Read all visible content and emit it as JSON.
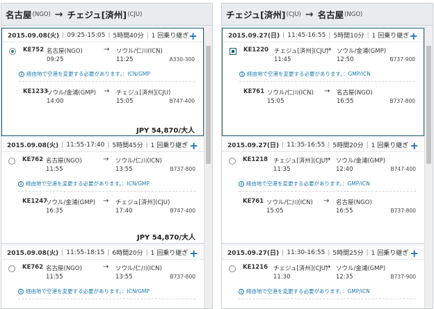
{
  "left": {
    "header": {
      "origin": "名古屋",
      "origin_code": "(NGO)",
      "arrow": "→",
      "dest": "チェジュ[済州]",
      "dest_code": "(CJU)"
    },
    "cards": [
      {
        "date": "2015.09.08(火)",
        "time": "09:25-15:05",
        "duration": "5時間40分",
        "stops": "1 回乗り継ぎ",
        "seg1": {
          "flight": "KE752",
          "from": "名古屋(NGO)",
          "to": "ソウル/仁川(ICN)",
          "dep": "09:25",
          "arr": "11:25",
          "aircraft": "A330-300"
        },
        "note": "経由地で空港を変更する必要があります。：ICN/GMP",
        "seg2": {
          "flight": "KE1233",
          "from": "ソウル/金浦(GMP)",
          "to": "チェジュ[済州](CJU)",
          "dep": "14:00",
          "arr": "15:05",
          "aircraft": "B747-400"
        },
        "price": "JPY 54,870/大人"
      },
      {
        "date": "2015.09.08(火)",
        "time": "11:55-17:40",
        "duration": "5時間45分",
        "stops": "1 回乗り継ぎ",
        "seg1": {
          "flight": "KE762",
          "from": "名古屋(NGO)",
          "to": "ソウル/仁川(ICN)",
          "dep": "11:55",
          "arr": "13:55",
          "aircraft": "B737-800"
        },
        "note": "経由地で空港を変更する必要があります。：ICN/GMP",
        "seg2": {
          "flight": "KE1247",
          "from": "ソウル/金浦(GMP)",
          "to": "チェジュ[済州](CJU)",
          "dep": "16:35",
          "arr": "17:40",
          "aircraft": "B747-400"
        },
        "price": "JPY 54,870/大人"
      },
      {
        "date": "2015.09.08(火)",
        "time": "11:55-18:15",
        "duration": "6時間20分",
        "stops": "1 回乗り継ぎ",
        "seg1": {
          "flight": "KE762",
          "from": "名古屋(NGO)",
          "to": "ソウル/仁川(ICN)",
          "dep": "11:55",
          "arr": "13:55",
          "aircraft": "B737-800"
        },
        "note": "経由地で空港を変更する必要があります。：ICN/GMP"
      }
    ]
  },
  "right": {
    "header": {
      "origin": "チェジュ[済州]",
      "origin_code": "(CJU)",
      "arrow": "→",
      "dest": "名古屋",
      "dest_code": "(NGO)"
    },
    "cards": [
      {
        "date": "2015.09.27(日)",
        "time": "11:45-16:55",
        "duration": "5時間10分",
        "stops": "1 回乗り継ぎ",
        "seg1": {
          "flight": "KE1220",
          "from": "チェジュ[済州](CJU)",
          "to": "ソウル/金浦(GMP)",
          "dep": "11:45",
          "arr": "12:50",
          "aircraft": "B737-900"
        },
        "note": "経由地で空港を変更する必要があります。：GMP/ICN",
        "seg2": {
          "flight": "KE761",
          "from": "ソウル/仁川(ICN)",
          "to": "名古屋(NGO)",
          "dep": "15:05",
          "arr": "16:55",
          "aircraft": "B737-800"
        }
      },
      {
        "date": "2015.09.27(日)",
        "time": "11:35-16:55",
        "duration": "5時間20分",
        "stops": "1 回乗り継ぎ",
        "seg1": {
          "flight": "KE1218",
          "from": "チェジュ[済州](CJU)",
          "to": "ソウル/金浦(GMP)",
          "dep": "11:35",
          "arr": "12:40",
          "aircraft": "B747-400"
        },
        "note": "経由地で空港を変更する必要があります。：GMP/ICN",
        "seg2": {
          "flight": "KE761",
          "from": "ソウル/仁川(ICN)",
          "to": "名古屋(NGO)",
          "dep": "15:05",
          "arr": "16:55",
          "aircraft": "B737-800"
        }
      },
      {
        "date": "2015.09.27(日)",
        "time": "11:30-16:55",
        "duration": "5時間25分",
        "stops": "1 回乗り継ぎ",
        "seg1": {
          "flight": "KE1216",
          "from": "チェジュ[済州](CJU)",
          "to": "ソウル/金浦(GMP)",
          "dep": "11:30",
          "arr": "12:35",
          "aircraft": "B737-900"
        },
        "note": "経由地で空港を変更する必要があります。：GMP/ICN"
      }
    ]
  },
  "info_icon": "i",
  "plus_icon": "+",
  "route_arrow": "→"
}
